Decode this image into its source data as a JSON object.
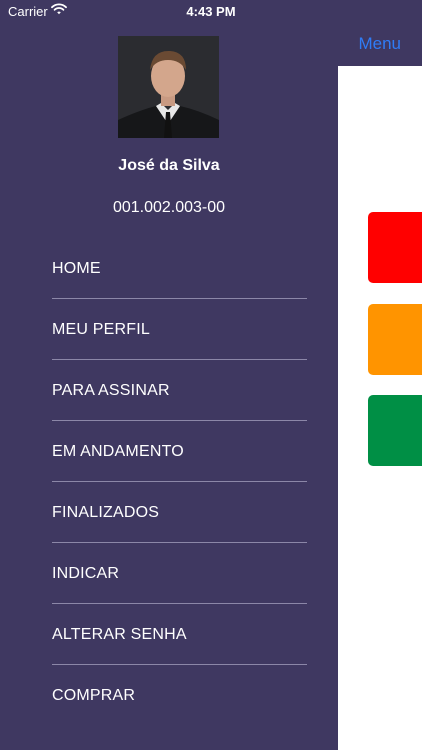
{
  "status_bar": {
    "carrier": "Carrier",
    "time": "4:43 PM"
  },
  "profile": {
    "name": "José da Silva",
    "id": "001.002.003-00"
  },
  "menu": {
    "items": [
      {
        "label": "HOME"
      },
      {
        "label": "MEU PERFIL"
      },
      {
        "label": "PARA ASSINAR"
      },
      {
        "label": "EM ANDAMENTO"
      },
      {
        "label": "FINALIZADOS"
      },
      {
        "label": "INDICAR"
      },
      {
        "label": "ALTERAR SENHA"
      },
      {
        "label": "COMPRAR"
      }
    ]
  },
  "nav": {
    "menu_label": "Menu"
  },
  "colors": {
    "drawer_background": "#3f3861",
    "accent": "#2f7cf6",
    "tile_red": "#ff0000",
    "tile_orange": "#ff9400",
    "tile_green": "#008f45"
  }
}
